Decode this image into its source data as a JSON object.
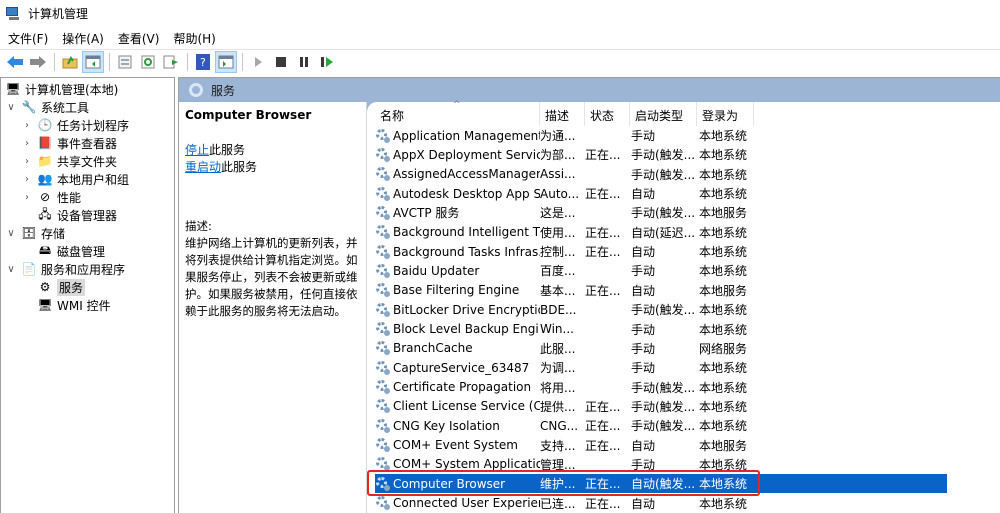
{
  "window": {
    "title": "计算机管理"
  },
  "menu": [
    "文件(F)",
    "操作(A)",
    "查看(V)",
    "帮助(H)"
  ],
  "toolbar": {
    "buttons": [
      "back",
      "forward",
      "up-folder",
      "show-hide-console-tree",
      "properties",
      "refresh",
      "export-list",
      "help",
      "show-hide-action-pane",
      "start",
      "stop",
      "pause",
      "restart"
    ]
  },
  "tree": {
    "root": "计算机管理(本地)",
    "items": [
      {
        "label": "系统工具",
        "expanded": true,
        "level": 1
      },
      {
        "label": "任务计划程序",
        "level": 2
      },
      {
        "label": "事件查看器",
        "level": 2
      },
      {
        "label": "共享文件夹",
        "level": 2
      },
      {
        "label": "本地用户和组",
        "level": 2
      },
      {
        "label": "性能",
        "level": 2
      },
      {
        "label": "设备管理器",
        "level": 2
      },
      {
        "label": "存储",
        "expanded": true,
        "level": 1
      },
      {
        "label": "磁盘管理",
        "level": 2
      },
      {
        "label": "服务和应用程序",
        "expanded": true,
        "level": 1
      },
      {
        "label": "服务",
        "level": 2,
        "selected": true
      },
      {
        "label": "WMI 控件",
        "level": 2
      }
    ]
  },
  "band_title": "服务",
  "detail": {
    "service_name": "Computer Browser",
    "stop_link": "停止",
    "stop_suffix": "此服务",
    "restart_link": "重启动",
    "restart_suffix": "此服务",
    "desc_label": "描述:",
    "description": "维护网络上计算机的更新列表，并将列表提供给计算机指定浏览。如果服务停止，列表不会被更新或维护。如果服务被禁用，任何直接依赖于此服务的服务将无法启动。"
  },
  "columns": [
    "名称",
    "描述",
    "状态",
    "启动类型",
    "登录为"
  ],
  "services": [
    {
      "name": "Application Management",
      "desc": "为通...",
      "status": "",
      "startup": "手动",
      "logon": "本地系统"
    },
    {
      "name": "AppX Deployment Servic...",
      "desc": "为部...",
      "status": "正在...",
      "startup": "手动(触发...",
      "logon": "本地系统"
    },
    {
      "name": "AssignedAccessManager...",
      "desc": "Assi...",
      "status": "",
      "startup": "手动(触发...",
      "logon": "本地系统"
    },
    {
      "name": "Autodesk Desktop App S...",
      "desc": "Auto...",
      "status": "正在...",
      "startup": "自动",
      "logon": "本地系统"
    },
    {
      "name": "AVCTP 服务",
      "desc": "这是...",
      "status": "",
      "startup": "手动(触发...",
      "logon": "本地服务"
    },
    {
      "name": "Background Intelligent T...",
      "desc": "使用...",
      "status": "正在...",
      "startup": "自动(延迟...",
      "logon": "本地系统"
    },
    {
      "name": "Background Tasks Infras...",
      "desc": "控制...",
      "status": "正在...",
      "startup": "自动",
      "logon": "本地系统"
    },
    {
      "name": "Baidu Updater",
      "desc": "百度...",
      "status": "",
      "startup": "手动",
      "logon": "本地系统"
    },
    {
      "name": "Base Filtering Engine",
      "desc": "基本...",
      "status": "正在...",
      "startup": "自动",
      "logon": "本地服务"
    },
    {
      "name": "BitLocker Drive Encryptio...",
      "desc": "BDE...",
      "status": "",
      "startup": "手动(触发...",
      "logon": "本地系统"
    },
    {
      "name": "Block Level Backup Engi...",
      "desc": "Win...",
      "status": "",
      "startup": "手动",
      "logon": "本地系统"
    },
    {
      "name": "BranchCache",
      "desc": "此服...",
      "status": "",
      "startup": "手动",
      "logon": "网络服务"
    },
    {
      "name": "CaptureService_63487",
      "desc": "为调...",
      "status": "",
      "startup": "手动",
      "logon": "本地系统"
    },
    {
      "name": "Certificate Propagation",
      "desc": "将用...",
      "status": "",
      "startup": "手动(触发...",
      "logon": "本地系统"
    },
    {
      "name": "Client License Service (Cli...",
      "desc": "提供...",
      "status": "正在...",
      "startup": "手动(触发...",
      "logon": "本地系统"
    },
    {
      "name": "CNG Key Isolation",
      "desc": "CNG...",
      "status": "正在...",
      "startup": "手动(触发...",
      "logon": "本地系统"
    },
    {
      "name": "COM+ Event System",
      "desc": "支持...",
      "status": "正在...",
      "startup": "自动",
      "logon": "本地服务"
    },
    {
      "name": "COM+ System Application",
      "desc": "管理...",
      "status": "",
      "startup": "手动",
      "logon": "本地系统"
    },
    {
      "name": "Computer Browser",
      "desc": "维护...",
      "status": "正在...",
      "startup": "自动(触发...",
      "logon": "本地系统",
      "selected": true
    },
    {
      "name": "Connected User Experien...",
      "desc": "已连...",
      "status": "正在...",
      "startup": "自动",
      "logon": "本地系统"
    }
  ],
  "colors": {
    "band": "#9cb5d4",
    "selection": "#0a64c8",
    "highlight": "#e3261f",
    "link": "#0066cc"
  }
}
